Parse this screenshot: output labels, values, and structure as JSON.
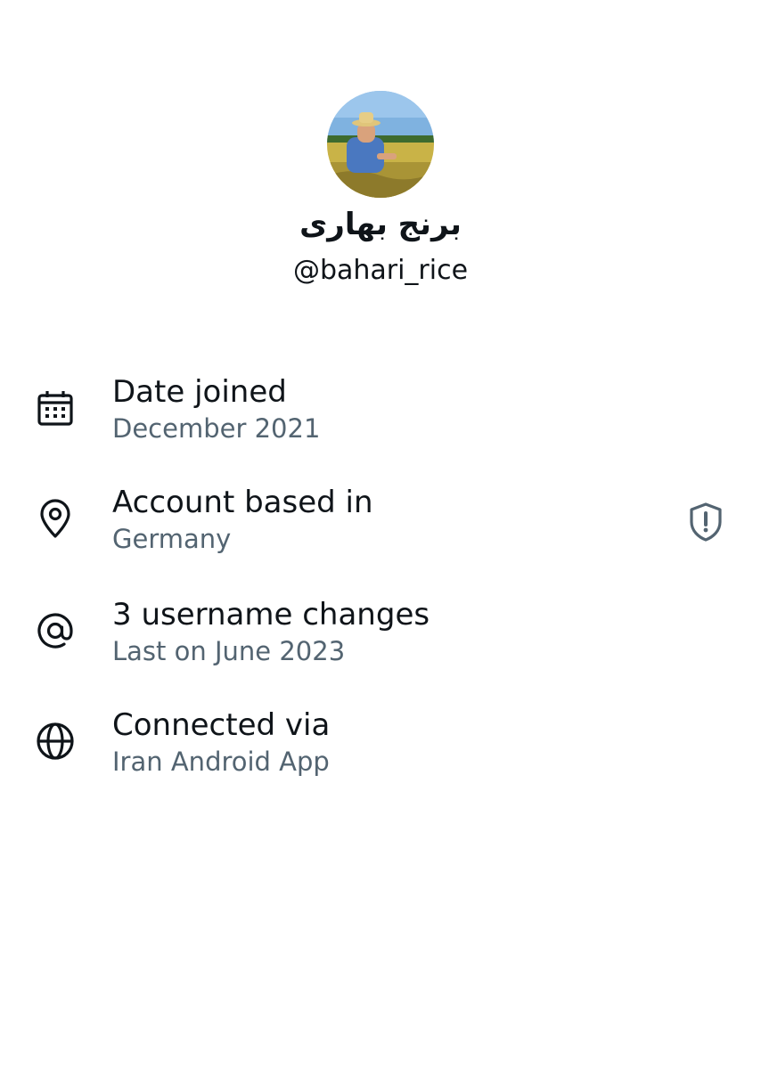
{
  "profile": {
    "display_name": "برنج بهاری",
    "handle": "@bahari_rice"
  },
  "rows": [
    {
      "icon": "calendar-icon",
      "title": "Date joined",
      "value": "December 2021"
    },
    {
      "icon": "location-pin-icon",
      "title": "Account based in",
      "value": "Germany",
      "trailing_icon": "shield-alert-icon"
    },
    {
      "icon": "at-sign-icon",
      "title": "3 username changes",
      "value": "Last on June 2023"
    },
    {
      "icon": "globe-icon",
      "title": "Connected via",
      "value": "Iran Android App"
    }
  ],
  "colors": {
    "primary_text": "#0f1419",
    "secondary_text": "#536471",
    "icon": "#0f1419",
    "trailing_icon": "#536471"
  }
}
